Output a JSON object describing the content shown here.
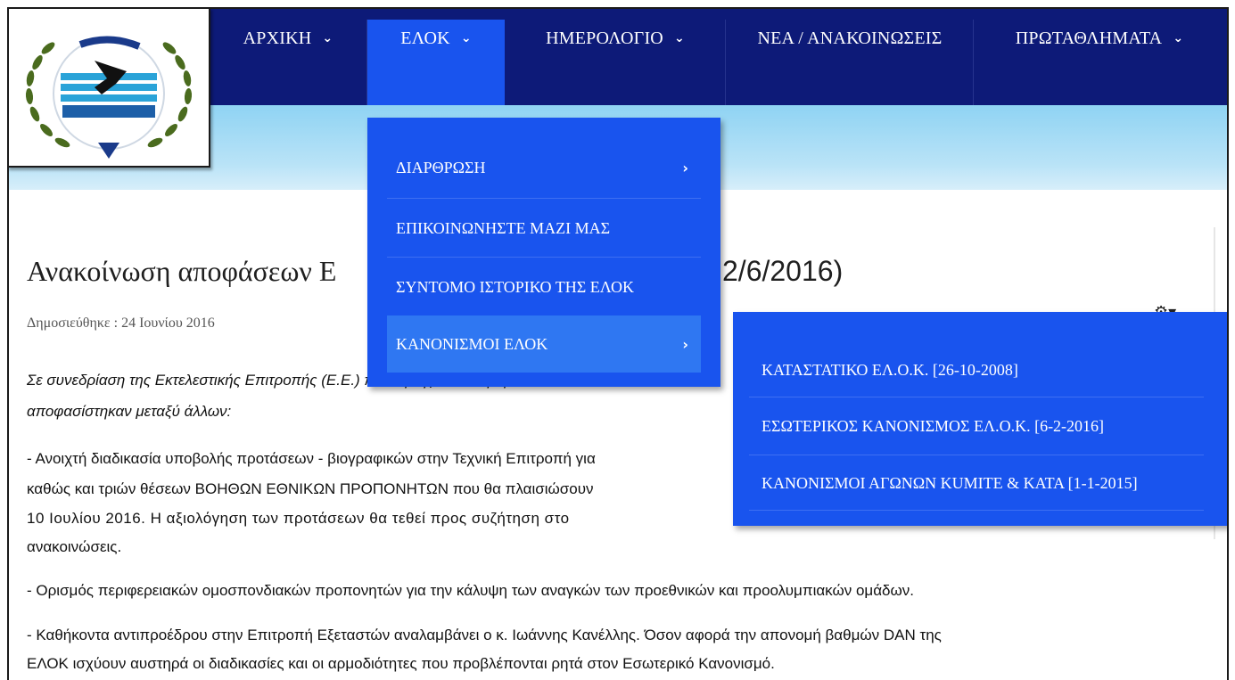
{
  "nav": {
    "items": [
      {
        "label": "ΑΡΧΙΚΗ",
        "chevron": true
      },
      {
        "label": "ΕΛΟΚ",
        "chevron": true,
        "active": true
      },
      {
        "label": "ΗΜΕΡΟΛΟΓΙΟ",
        "chevron": true
      },
      {
        "label": "ΝΕΑ / ΑΝΑΚΟΙΝΩΣΕΙΣ",
        "chevron": false
      },
      {
        "label": "ΠΡΩΤΑΘΛΗΜΑΤΑ",
        "chevron": true
      }
    ]
  },
  "dropdown": {
    "items": [
      {
        "label": "ΔΙΑΡΘΡΩΣΗ",
        "has_submenu": true
      },
      {
        "label": "ΕΠΙΚΟΙΝΩΝΗΣΤΕ ΜΑΖΙ ΜΑΣ",
        "has_submenu": false
      },
      {
        "label": "ΣΥΝΤΟΜΟ ΙΣΤΟΡΙΚΟ ΤΗΣ ΕΛΟΚ",
        "has_submenu": false
      },
      {
        "label": "ΚΑΝΟΝΙΣΜΟΙ ΕΛΟΚ",
        "has_submenu": true,
        "highlighted": true
      }
    ]
  },
  "submenu": {
    "items": [
      {
        "label": "ΚΑΤΑΣΤΑΤΙΚΟ ΕΛ.Ο.Κ. [26-10-2008]"
      },
      {
        "label": "ΕΣΩΤΕΡΙΚΟΣ ΚΑΝΟΝΙΣΜΟΣ ΕΛ.Ο.Κ. [6-2-2016]"
      },
      {
        "label": "ΚΑΝΟΝΙΣΜΟΙ ΑΓΩΝΩΝ KUMITE & KATA [1-1-2015]"
      }
    ]
  },
  "article": {
    "title_start": "Ανακοίνωση αποφάσεων Ε",
    "title_end": "2/6/2016)",
    "published_label": "Δημοσιεύθηκε : 24 Ιουνίου 2016",
    "p1_line1": "Σε συνεδρίαση της Εκτελεστικής Επιτροπής (Ε.Ε.) που πραγματοποιήθηκε στα",
    "p1_line2": "αποφασίστηκαν μεταξύ άλλων:",
    "p2_line1": "- Ανοιχτή διαδικασία υποβολής προτάσεων - βιογραφικών στην Τεχνική Επιτροπή για",
    "p2_line2": "καθώς και τριών θέσεων ΒΟΗΘΩΝ ΕΘΝΙΚΩΝ ΠΡΟΠΟΝΗΤΩΝ που θα πλαισιώσουν",
    "p2_line3": "10 Ιουλίου 2016. Η αξιολόγηση των προτάσεων θα τεθεί προς συζήτηση στο",
    "p2_line4": "ανακοινώσεις.",
    "p3": "- Ορισμός περιφερειακών ομοσπονδιακών προπονητών για την κάλυψη των αναγκών των προεθνικών και προολυμπιακών ομάδων.",
    "p4_line1": "- Καθήκοντα αντιπροέδρου στην Επιτροπή Εξεταστών αναλαμβάνει ο κ. Ιωάννης Κανέλλης. Όσον αφορά την απονομή βαθμών DAN της",
    "p4_line2": "ΕΛΟΚ ισχύουν αυστηρά οι διαδικασίες και οι αρμοδιότητες που προβλέπονται ρητά στον Εσωτερικό Κανονισμό."
  },
  "colors": {
    "topbar": "#0d1a78",
    "active_blue": "#1954ee",
    "highlight": "#2f77f2",
    "subbar": "#b9e3f7"
  },
  "icons": {
    "chevron": "chevron-down-icon",
    "arrow": "chevron-right-icon",
    "gear": "gear-icon"
  }
}
